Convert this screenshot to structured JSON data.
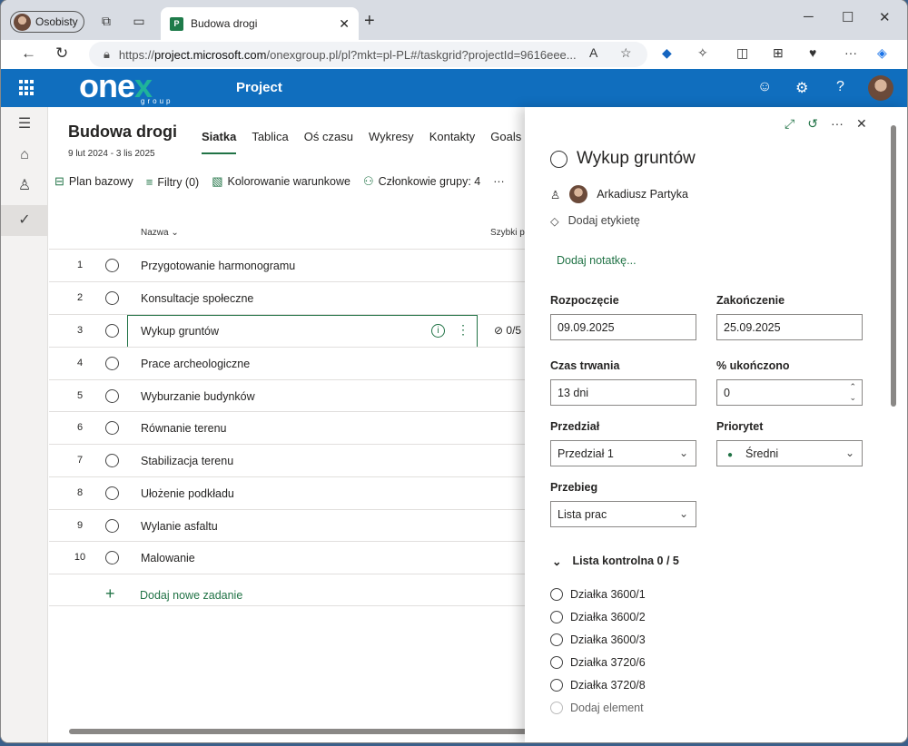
{
  "browser": {
    "profile_label": "Osobisty",
    "tab_title": "Budowa drogi",
    "url_prefix": "https://",
    "url_host": "project.microsoft.com",
    "url_rest": "/onexgroup.pl/pl?mkt=pl-PL#/taskgrid?projectId=9616eee..."
  },
  "app": {
    "logo_text_main": "one",
    "logo_text_x": "x",
    "logo_sub": "group",
    "title": "Project"
  },
  "project": {
    "title": "Budowa drogi",
    "dates": "9 lut 2024 - 3 lis 2025",
    "views": [
      "Siatka",
      "Tablica",
      "Oś czasu",
      "Wykresy",
      "Kontakty",
      "Goals"
    ]
  },
  "toolbar": {
    "baseline": "Plan bazowy",
    "filters": "Filtry (0)",
    "coloring": "Kolorowanie warunkowe",
    "members": "Członkowie grupy: 4",
    "more": "···"
  },
  "grid": {
    "col_name": "Nazwa",
    "col_quick": "Szybki p",
    "checklist_preview": "0/5",
    "rows": [
      {
        "num": "1",
        "name": "Przygotowanie harmonogramu"
      },
      {
        "num": "2",
        "name": "Konsultacje społeczne"
      },
      {
        "num": "3",
        "name": "Wykup gruntów"
      },
      {
        "num": "4",
        "name": "Prace archeologiczne"
      },
      {
        "num": "5",
        "name": "Wyburzanie budynków"
      },
      {
        "num": "6",
        "name": "Równanie terenu"
      },
      {
        "num": "7",
        "name": "Stabilizacja terenu"
      },
      {
        "num": "8",
        "name": "Ułożenie podkładu"
      },
      {
        "num": "9",
        "name": "Wylanie asfaltu"
      },
      {
        "num": "10",
        "name": "Malowanie"
      }
    ],
    "add_task": "Dodaj nowe zadanie"
  },
  "panel": {
    "task_title": "Wykup gruntów",
    "assignee": "Arkadiusz Partyka",
    "add_label": "Dodaj etykietę",
    "add_note": "Dodaj notatkę...",
    "start_label": "Rozpoczęcie",
    "start_value": "09.09.2025",
    "end_label": "Zakończenie",
    "end_value": "25.09.2025",
    "duration_label": "Czas trwania",
    "duration_value": "13 dni",
    "percent_label": "% ukończono",
    "percent_value": "0",
    "bucket_label": "Przedział",
    "bucket_value": "Przedział 1",
    "priority_label": "Priorytet",
    "priority_value": "Średni",
    "progress_label": "Przebieg",
    "progress_value": "Lista prac",
    "checklist_title": "Lista kontrolna 0 / 5",
    "checklist": [
      "Działka 3600/1",
      "Działka 3600/2",
      "Działka 3600/3",
      "Działka 3720/6",
      "Działka 3720/8"
    ],
    "add_item": "Dodaj element"
  },
  "colors": {
    "brand_blue": "#106ebe",
    "accent_green": "#217346",
    "logo_accent": "#1fb39a"
  }
}
